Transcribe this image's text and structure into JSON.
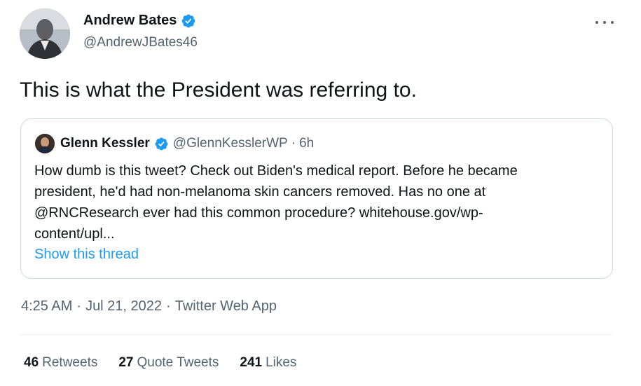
{
  "tweet": {
    "author": {
      "name": "Andrew Bates",
      "handle": "@AndrewJBates46"
    },
    "text": "This is what the President was referring to.",
    "quoted": {
      "name": "Glenn Kessler",
      "handle": "@GlennKesslerWP",
      "separator": "·",
      "time": "6h",
      "lines": [
        "How dumb is this tweet? Check out Biden's medical report. Before he became",
        "president, he'd had non-melanoma skin cancers removed. Has no one  at",
        "@RNCResearch ever had this common procedure?  whitehouse.gov/wp-",
        "content/upl..."
      ],
      "show_thread": "Show this thread"
    },
    "meta": {
      "time": "4:25 AM",
      "sep": "·",
      "date": "Jul 21, 2022",
      "app": "Twitter Web App"
    },
    "stats": {
      "retweets": {
        "count": "46",
        "label": "Retweets"
      },
      "quotes": {
        "count": "27",
        "label": "Quote Tweets"
      },
      "likes": {
        "count": "241",
        "label": "Likes"
      }
    }
  },
  "icons": {
    "verified": "verified-badge-icon",
    "more": "more-options-icon"
  },
  "colors": {
    "verified": "#1d9bf0",
    "link": "#1d9bf0",
    "secondary_text": "#536471",
    "border": "#cfd9de"
  }
}
